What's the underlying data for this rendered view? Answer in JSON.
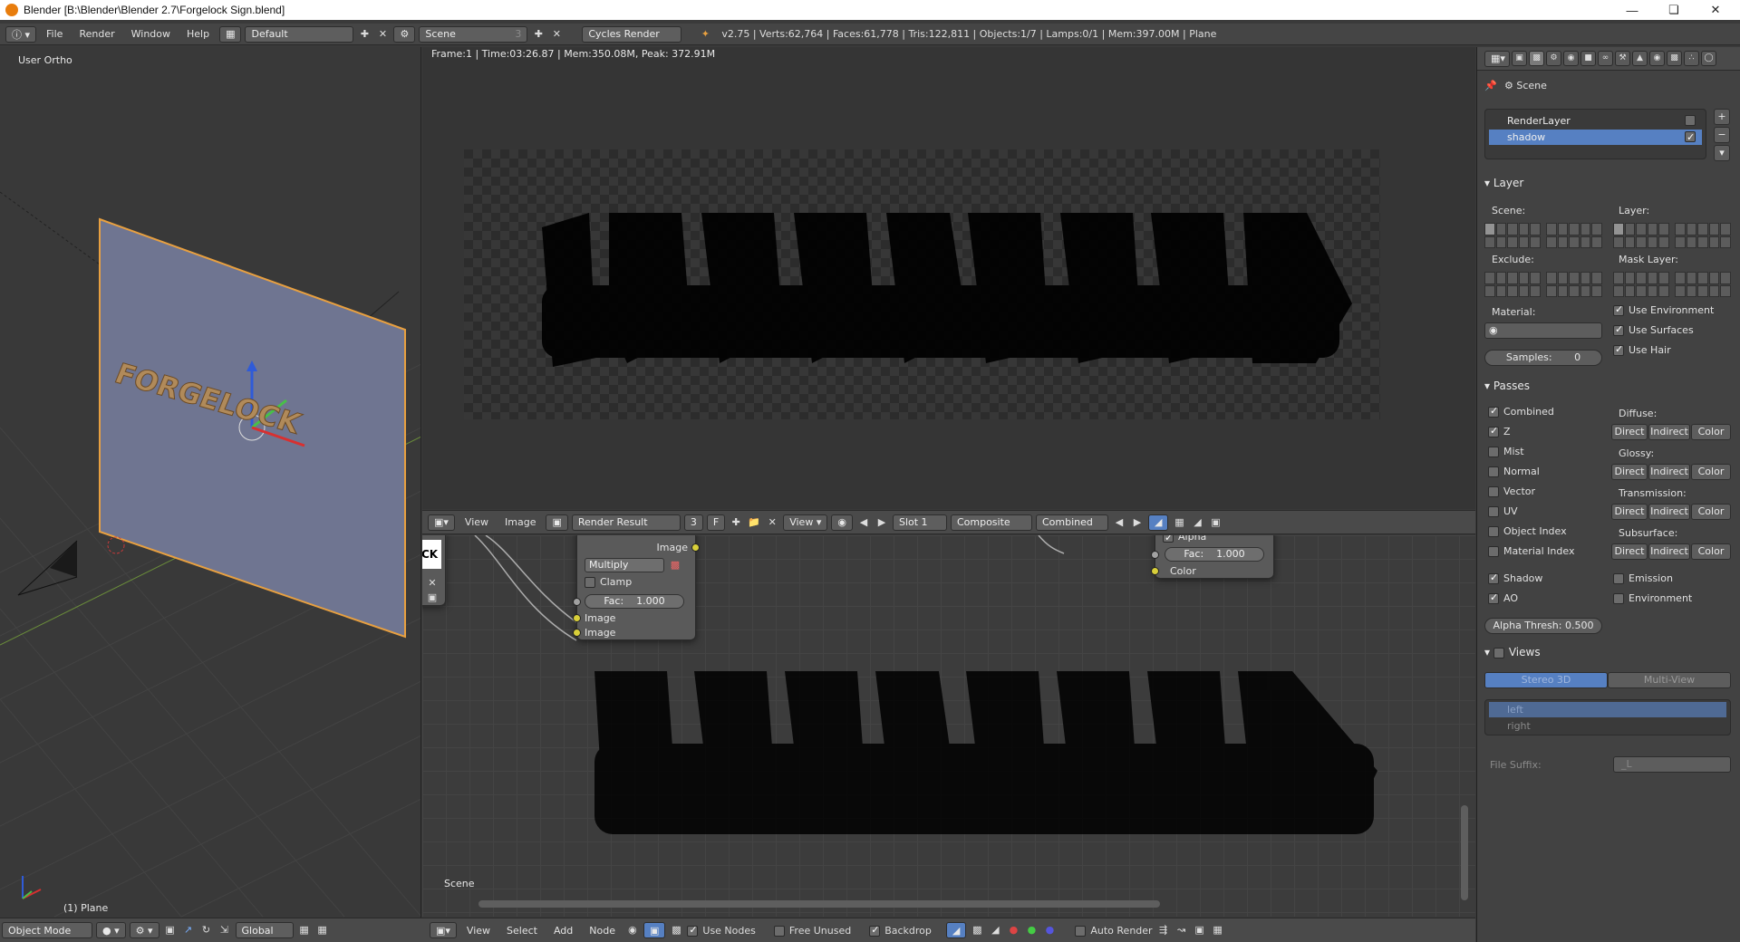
{
  "window": {
    "title": "Blender [B:\\Blender\\Blender 2.7\\Forgelock Sign.blend]"
  },
  "info_header": {
    "menus": [
      "File",
      "Render",
      "Window",
      "Help"
    ],
    "screen_layout": "Default",
    "scene": "Scene",
    "scene_users": "3",
    "render_engine": "Cycles Render",
    "stats": "v2.75 | Verts:62,764 | Faces:61,778 | Tris:122,811 | Objects:1/7 | Lamps:0/1 | Mem:397.00M | Plane"
  },
  "viewport_3d": {
    "view_label": "User Ortho",
    "object_label": "(1) Plane",
    "sign_text": "FORGELOCK",
    "header": {
      "mode": "Object Mode",
      "orientation": "Global"
    }
  },
  "image_editor": {
    "status": "Frame:1 | Time:03:26.87 | Mem:350.08M, Peak: 372.91M",
    "header": {
      "menus": [
        "View",
        "Image"
      ],
      "image_name": "Render Result",
      "image_users": "3",
      "fake_user": "F",
      "view_label": "View",
      "slot": "Slot 1",
      "layer": "Composite",
      "pass": "Combined"
    }
  },
  "node_editor": {
    "mix_node": {
      "output_label": "Image",
      "blend_mode": "Multiply",
      "clamp_label": "Clamp",
      "fac_label": "Fac:",
      "fac_value": "1.000",
      "input1": "Image",
      "input2": "Image"
    },
    "alpha_node": {
      "alpha_label": "Alpha",
      "fac_label": "Fac:",
      "fac_value": "1.000",
      "color_label": "Color"
    },
    "partial_node_text": "CK",
    "scene_label": "Scene",
    "header": {
      "menus": [
        "View",
        "Select",
        "Add",
        "Node"
      ],
      "use_nodes": "Use Nodes",
      "free_unused": "Free Unused",
      "backdrop": "Backdrop",
      "auto_render": "Auto Render"
    }
  },
  "properties": {
    "scene_label": "Scene",
    "render_layers": [
      {
        "name": "RenderLayer",
        "selected": false
      },
      {
        "name": "shadow",
        "selected": true
      }
    ],
    "layer_panel": {
      "title": "Layer",
      "scene_label": "Scene:",
      "layer_label": "Layer:",
      "exclude_label": "Exclude:",
      "mask_layer_label": "Mask Layer:",
      "material_label": "Material:",
      "use_environment": "Use Environment",
      "use_surfaces": "Use Surfaces",
      "use_hair": "Use Hair",
      "samples_label": "Samples:",
      "samples_value": "0"
    },
    "passes_panel": {
      "title": "Passes",
      "left": [
        {
          "label": "Combined",
          "checked": true
        },
        {
          "label": "Z",
          "checked": true
        },
        {
          "label": "Mist",
          "checked": false
        },
        {
          "label": "Normal",
          "checked": false
        },
        {
          "label": "Vector",
          "checked": false
        },
        {
          "label": "UV",
          "checked": false
        },
        {
          "label": "Object Index",
          "checked": false
        },
        {
          "label": "Material Index",
          "checked": false
        }
      ],
      "groups": [
        {
          "label": "Diffuse:",
          "buttons": [
            "Direct",
            "Indirect",
            "Color"
          ]
        },
        {
          "label": "Glossy:",
          "buttons": [
            "Direct",
            "Indirect",
            "Color"
          ]
        },
        {
          "label": "Transmission:",
          "buttons": [
            "Direct",
            "Indirect",
            "Color"
          ]
        },
        {
          "label": "Subsurface:",
          "buttons": [
            "Direct",
            "Indirect",
            "Color"
          ]
        }
      ],
      "shadow": "Shadow",
      "ao": "AO",
      "emission": "Emission",
      "environment": "Environment",
      "alpha_thresh": "Alpha Thresh: 0.500"
    },
    "views_panel": {
      "title": "Views",
      "tabs": [
        "Stereo 3D",
        "Multi-View"
      ],
      "views": [
        "left",
        "right"
      ],
      "file_suffix_label": "File Suffix:",
      "file_suffix_value": "_L"
    }
  },
  "colors": {
    "accent_blue": "#5680c2",
    "selection_orange": "#e8a040",
    "socket_yellow": "#d8cf3a"
  }
}
